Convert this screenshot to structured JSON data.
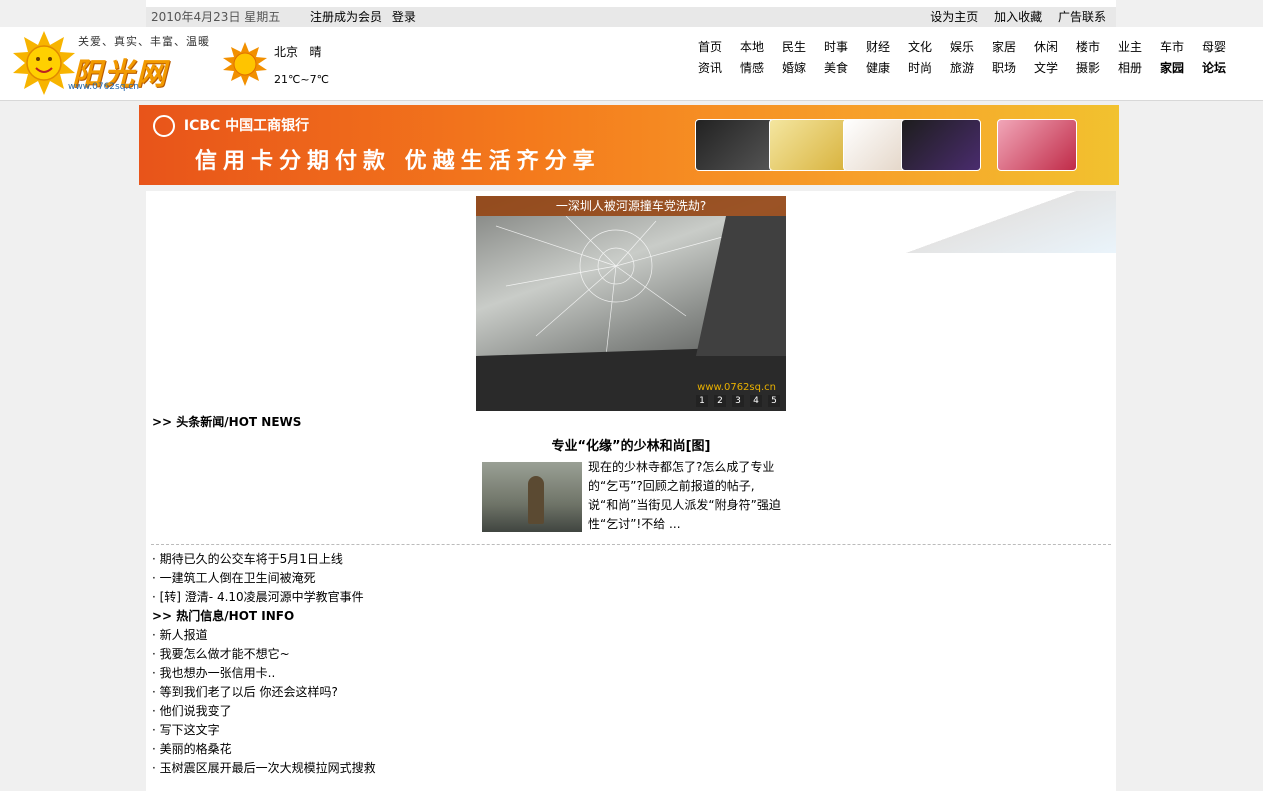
{
  "topbar": {
    "date": "2010年4月23日  星期五",
    "register": "注册成为会员",
    "login": "登录",
    "set_home": "设为主页",
    "favorite": "加入收藏",
    "ad_contact": "广告联系"
  },
  "logo": {
    "slogan": "关爱、真实、丰富、温暖",
    "name": "阳光网",
    "url": "www.0762sq.cn"
  },
  "weather": {
    "city": "北京",
    "condition": "晴",
    "temp": "21℃~7℃"
  },
  "nav": {
    "row1": [
      "首页",
      "本地",
      "民生",
      "时事",
      "财经",
      "文化",
      "娱乐",
      "家居",
      "休闲",
      "楼市",
      "业主",
      "车市",
      "母婴"
    ],
    "row2": [
      "资讯",
      "情感",
      "婚嫁",
      "美食",
      "健康",
      "时尚",
      "旅游",
      "职场",
      "文学",
      "摄影",
      "相册",
      "家园",
      "论坛"
    ]
  },
  "banner": {
    "bank": "ICBC  中国工商银行",
    "slogan": "信用卡分期付款   优越生活齐分享"
  },
  "slideshow": {
    "caption": "一深圳人被河源撞车党洗劫?",
    "watermark": "www.0762sq.cn",
    "pages": [
      "1",
      "2",
      "3",
      "4",
      "5"
    ]
  },
  "hot_news": {
    "title": ">> 头条新闻/HOT NEWS",
    "headline": "专业“化缘”的少林和尚[图]",
    "summary": "现在的少林寺都怎了?怎么成了专业的“乞丐”?回顾之前报道的帖子,说“和尚”当街见人派发“附身符”强迫性“乞讨”!不给 ...",
    "items": [
      "· 期待已久的公交车将于5月1日上线",
      "· 一建筑工人倒在卫生间被淹死",
      "· [转] 澄清- 4.10凌晨河源中学教官事件"
    ]
  },
  "hot_info": {
    "title": ">> 热门信息/HOT INFO",
    "items": [
      "· 新人报道",
      "· 我要怎么做才能不想它~",
      "· 我也想办一张信用卡..",
      "· 等到我们老了以后  你还会这样吗?",
      "· 他们说我变了",
      "· 写下这文字",
      "· 美丽的格桑花",
      "· 玉树震区展开最后一次大规模拉网式搜救"
    ]
  }
}
